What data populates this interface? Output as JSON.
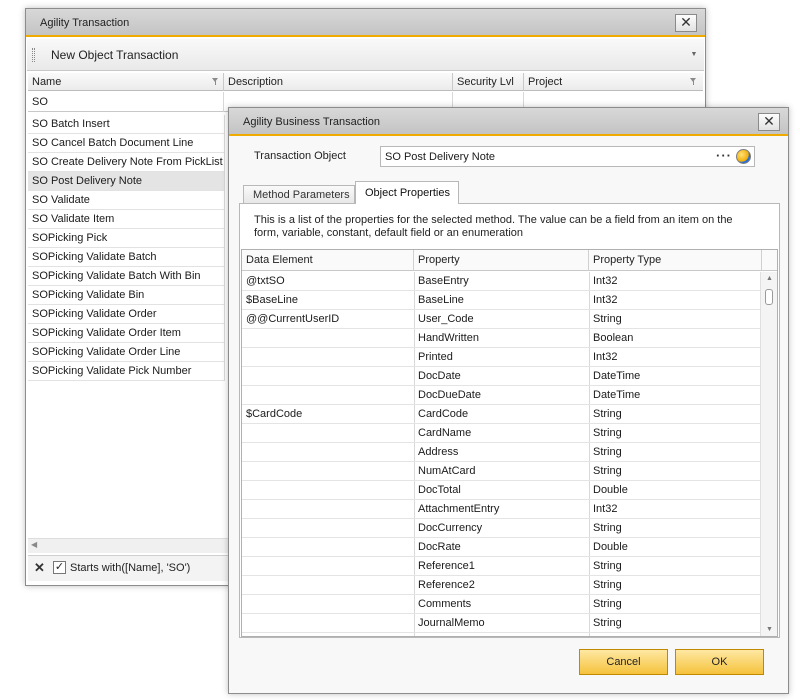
{
  "main_window": {
    "title": "Agility Transaction",
    "toolbar_label": "New Object Transaction",
    "columns": [
      "Name",
      "Description",
      "Security Lvl",
      "Project"
    ],
    "filter_value": "SO",
    "items": [
      "SO Batch Insert",
      "SO Cancel Batch Document Line",
      "SO Create Delivery Note From PickList",
      "SO Post Delivery Note",
      "SO Validate",
      "SO Validate Item",
      "SOPicking Pick",
      "SOPicking Validate Batch",
      "SOPicking Validate Batch With Bin",
      "SOPicking Validate Bin",
      "SOPicking Validate Order",
      "SOPicking Validate Order Item",
      "SOPicking Validate Order Line",
      "SOPicking Validate Pick Number"
    ],
    "selected_item": "SO Post Delivery Note",
    "filter_expression": "Starts with([Name], 'SO')"
  },
  "dialog": {
    "title": "Agility Business Transaction",
    "transaction_object_label": "Transaction Object",
    "transaction_object_value": "SO Post Delivery Note",
    "tabs": [
      "Method Parameters",
      "Object Properties"
    ],
    "active_tab": "Object Properties",
    "description": "This is a list of the properties for the selected method. The value can be a field from an item on the form, variable, constant, default field or an enumeration",
    "grid_headers": [
      "Data Element",
      "Property",
      "Property Type"
    ],
    "rows": [
      {
        "element": "@txtSO",
        "property": "BaseEntry",
        "type": "Int32"
      },
      {
        "element": "$BaseLine",
        "property": "BaseLine",
        "type": "Int32"
      },
      {
        "element": "@@CurrentUserID",
        "property": "User_Code",
        "type": "String"
      },
      {
        "element": "",
        "property": "HandWritten",
        "type": "Boolean"
      },
      {
        "element": "",
        "property": "Printed",
        "type": "Int32"
      },
      {
        "element": "",
        "property": "DocDate",
        "type": "DateTime"
      },
      {
        "element": "",
        "property": "DocDueDate",
        "type": "DateTime"
      },
      {
        "element": "$CardCode",
        "property": "CardCode",
        "type": "String"
      },
      {
        "element": "",
        "property": "CardName",
        "type": "String"
      },
      {
        "element": "",
        "property": "Address",
        "type": "String"
      },
      {
        "element": "",
        "property": "NumAtCard",
        "type": "String"
      },
      {
        "element": "",
        "property": "DocTotal",
        "type": "Double"
      },
      {
        "element": "",
        "property": "AttachmentEntry",
        "type": "Int32"
      },
      {
        "element": "",
        "property": "DocCurrency",
        "type": "String"
      },
      {
        "element": "",
        "property": "DocRate",
        "type": "Double"
      },
      {
        "element": "",
        "property": "Reference1",
        "type": "String"
      },
      {
        "element": "",
        "property": "Reference2",
        "type": "String"
      },
      {
        "element": "",
        "property": "Comments",
        "type": "String"
      },
      {
        "element": "",
        "property": "JournalMemo",
        "type": "String"
      }
    ],
    "cancel_label": "Cancel",
    "ok_label": "OK"
  },
  "colors": {
    "accent": "#f0ab00",
    "button_fill": "#f5c23c",
    "selection": "#e4e4e4"
  },
  "icons": {
    "close": "close-icon",
    "filter": "funnel-icon",
    "clear_filter": "x-icon",
    "link": "link-icon"
  }
}
